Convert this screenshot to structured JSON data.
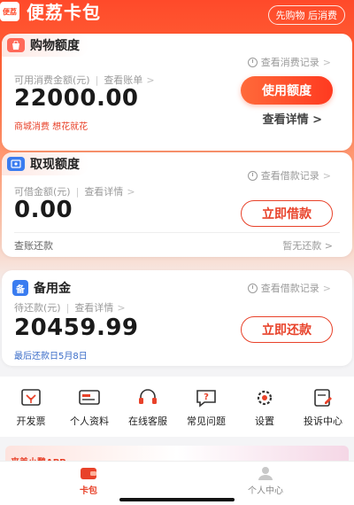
{
  "header": {
    "logo_text": "便荔",
    "title": "便荔卡包",
    "slogan": "先购物 后消费"
  },
  "shopping_card": {
    "tab_label": "购物额度",
    "record_link": "查看消费记录",
    "amount_label": "可用消费金额(元)",
    "bill_link": "查看账单",
    "amount": "22000.00",
    "promo": "商城消费 想花就花",
    "primary_button": "使用额度",
    "detail_link": "查看详情 >"
  },
  "cash_card": {
    "tab_label": "取现额度",
    "record_link": "查看借款记录",
    "amount_label": "可借金额(元)",
    "detail_link": "查看详情",
    "amount": "0.00",
    "button": "立即借款",
    "footer_left": "查账还款",
    "footer_right": "暂无还款"
  },
  "reserve_card": {
    "tab_label": "备用金",
    "record_link": "查看借款记录",
    "amount_label": "待还款(元)",
    "detail_link": "查看详情",
    "amount": "20459.99",
    "button": "立即还款",
    "last_repay": "最后还款日5月8日"
  },
  "shortcuts": [
    {
      "label": "开发票",
      "icon": "invoice-icon"
    },
    {
      "label": "个人资料",
      "icon": "id-card-icon"
    },
    {
      "label": "在线客服",
      "icon": "headset-icon"
    },
    {
      "label": "常见问题",
      "icon": "question-icon"
    },
    {
      "label": "设置",
      "icon": "gear-icon"
    },
    {
      "label": "投诉中心",
      "icon": "complaint-icon"
    }
  ],
  "banner": {
    "text": "来美小鹏APP"
  },
  "tabbar": {
    "items": [
      {
        "label": "卡包",
        "icon": "wallet-icon",
        "active": true
      },
      {
        "label": "个人中心",
        "icon": "user-icon",
        "active": false
      }
    ]
  },
  "colors": {
    "brand": "#ff4a2a",
    "accent_red": "#e8422a",
    "muted": "#9a9a9a"
  }
}
